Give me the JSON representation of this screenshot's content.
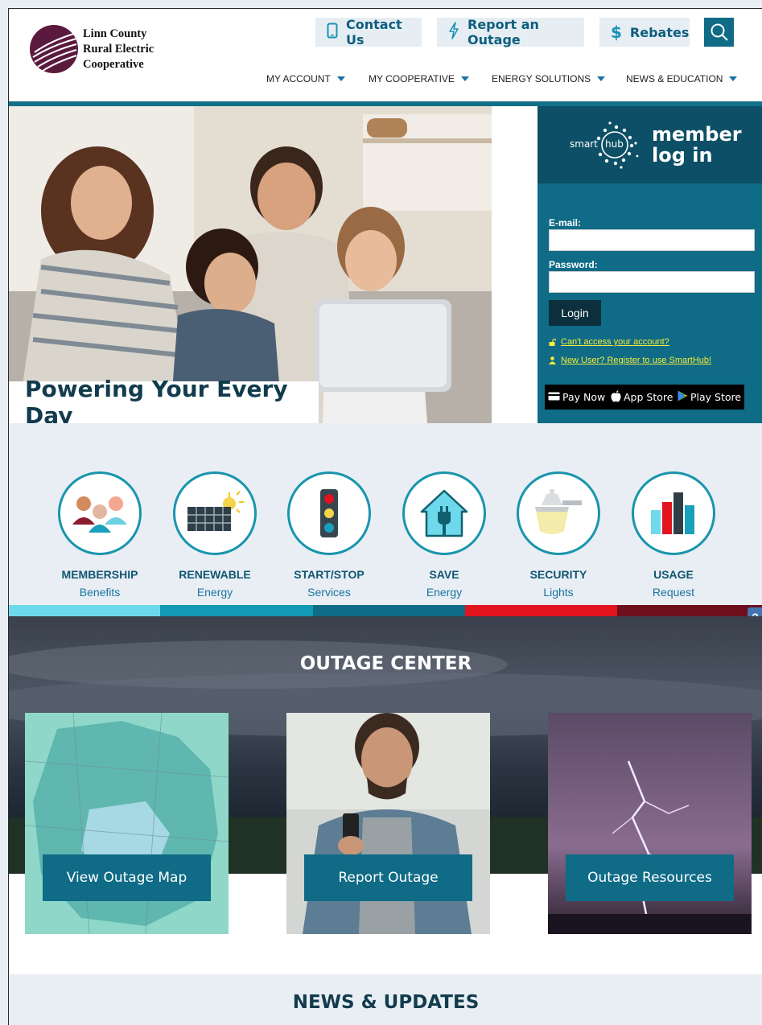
{
  "brand": {
    "name_line1": "Linn County",
    "name_line2": "Rural Electric",
    "name_line3": "Cooperative"
  },
  "top_buttons": {
    "contact": "Contact Us",
    "outage": "Report an Outage",
    "rebates": "Rebates"
  },
  "nav": [
    {
      "label": "MY ACCOUNT"
    },
    {
      "label": "MY COOPERATIVE"
    },
    {
      "label": "ENERGY SOLUTIONS"
    },
    {
      "label": "NEWS & EDUCATION"
    }
  ],
  "hero": {
    "tagline": "Powering Your Every Day"
  },
  "login": {
    "smart_text": "smart",
    "hub_text": "hub",
    "title_line1": "member",
    "title_line2": "log in",
    "email_label": "E-mail:",
    "password_label": "Password:",
    "login_button": "Login",
    "cant_access": "Can't access your account?",
    "register": "New User? Register to use SmartHub!",
    "pay_now": "Pay Now",
    "app_store": "App Store",
    "play_store": "Play Store"
  },
  "services": [
    {
      "title": "MEMBERSHIP",
      "sub": "Benefits",
      "icon": "people-icon"
    },
    {
      "title": "RENEWABLE",
      "sub": "Energy",
      "icon": "solar-panel-icon"
    },
    {
      "title": "START/STOP",
      "sub": "Services",
      "icon": "traffic-light-icon"
    },
    {
      "title": "SAVE",
      "sub": "Energy",
      "icon": "house-plug-icon"
    },
    {
      "title": "SECURITY",
      "sub": "Lights",
      "icon": "security-light-icon"
    },
    {
      "title": "USAGE",
      "sub": "Request",
      "icon": "bar-chart-icon"
    }
  ],
  "stripe_colors": [
    "#6fd9ec",
    "#1399b4",
    "#0f6b86",
    "#e0131f",
    "#6e0f1e"
  ],
  "help_icon": "?",
  "outage": {
    "title": "OUTAGE CENTER",
    "cards": [
      {
        "label": "View Outage Map"
      },
      {
        "label": "Report Outage"
      },
      {
        "label": "Outage Resources"
      }
    ]
  },
  "news": {
    "title": "NEWS & UPDATES"
  }
}
